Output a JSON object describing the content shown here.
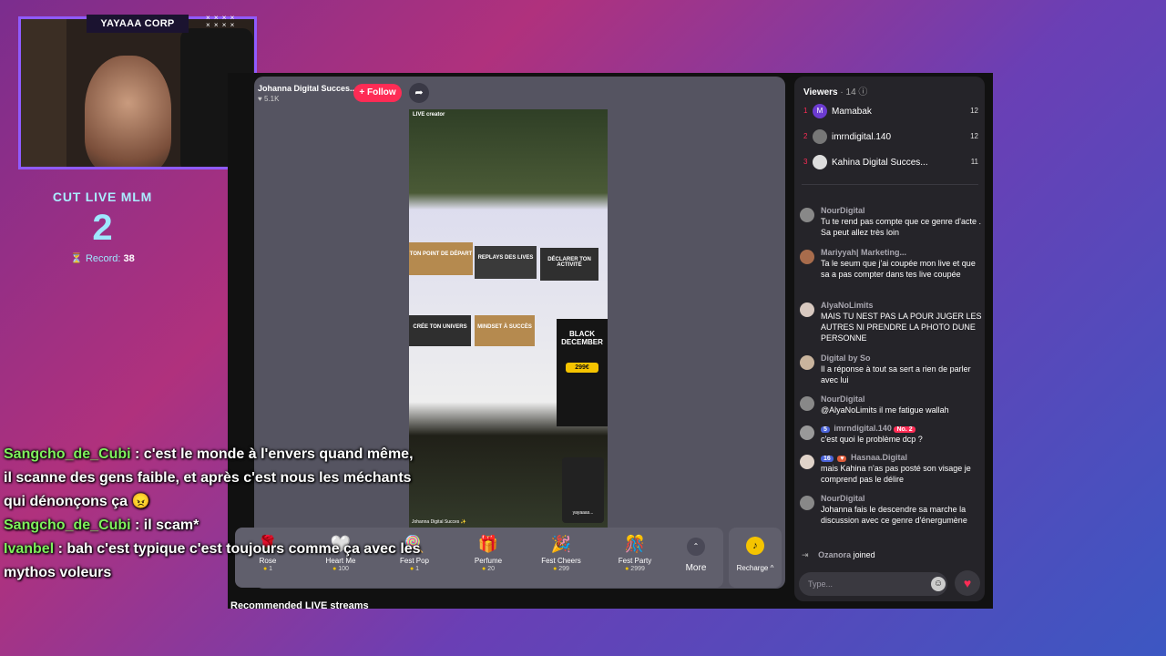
{
  "overlay": {
    "cam_label": "YAYAAA CORP",
    "cam_dots": "× × × ×\n× × × ×",
    "counter_title": "CUT LIVE MLM",
    "counter_value": "2",
    "record_label": "Record:",
    "record_value": "38"
  },
  "live": {
    "host_name": "Johanna Digital Succes...",
    "host_likes": "♥ 5.1K",
    "follow_label": "+ Follow",
    "share_icon": "share-icon"
  },
  "phone": {
    "live_tag": "LIVE creator",
    "card1": "TON POINT DE DÉPART",
    "card2": "REPLAYS DES LIVES",
    "card3": "DÉCLARER TON ACTIVITÉ",
    "card4": "CRÉE TON UNIVERS",
    "card5": "MINDSET À SUCCÈS",
    "promo_title": "BLACK DECEMBER",
    "promo_price": "299€",
    "mini_label": "yayaaas...",
    "footer": "Johanna Digital Succes ✨"
  },
  "gifts": [
    {
      "icon": "🌹",
      "name": "Rose",
      "price": "1"
    },
    {
      "icon": "🤍",
      "name": "Heart Me",
      "price": "100"
    },
    {
      "icon": "🍭",
      "name": "Fest Pop",
      "price": "1"
    },
    {
      "icon": "🎁",
      "name": "Perfume",
      "price": "20"
    },
    {
      "icon": "🎉",
      "name": "Fest Cheers",
      "price": "299"
    },
    {
      "icon": "🎊",
      "name": "Fest Party",
      "price": "2999"
    }
  ],
  "more_label": "More",
  "recharge_label": "Recharge ^",
  "recommended_title": "Recommended LIVE streams",
  "viewers": {
    "title": "Viewers",
    "count": "· 14 ⓘ",
    "list": [
      {
        "rank": "1",
        "initial": "M",
        "name": "Mamabak",
        "score": "12"
      },
      {
        "rank": "2",
        "initial": "",
        "name": "imrndigital.140",
        "score": "12"
      },
      {
        "rank": "3",
        "initial": "",
        "name": "Kahina Digital Succes...",
        "score": "11"
      }
    ]
  },
  "chat": [
    {
      "user": "NourDigital",
      "text": "Tu te rend pas compte que ce genre d'acte . Sa peut allez très loin"
    },
    {
      "user": "Mariyyah| Marketing...",
      "text": "Ta le seum que j'ai coupée mon live et que sa a pas compter dans tes live coupée"
    },
    {
      "user": "AlyaNoLimits",
      "text": "MAIS TU NEST PAS LA POUR JUGER LES AUTRES NI PRENDRE LA PHOTO DUNE PERSONNE"
    },
    {
      "user": "Digital by So",
      "text": "Il a réponse à tout sa sert a rien de parler avec lui"
    },
    {
      "user": "NourDigital",
      "text": "@AlyaNoLimits il me fatigue wallah"
    },
    {
      "user": "imrndigital.140",
      "badge1": "5",
      "badge2": "No. 2",
      "text": "c'est quoi le problème dcp ?"
    },
    {
      "user": "Hasnaa.Digital",
      "badge1": "16",
      "text": "mais Kahina n'as pas posté son visage je comprend pas le délire"
    },
    {
      "user": "NourDigital",
      "text": "Johanna fais le descendre sa marche la discussion avec ce genre d'énergumène"
    }
  ],
  "joined": {
    "user": "Ozanora",
    "text": "joined"
  },
  "input_placeholder": "Type...",
  "twitch_chat": [
    {
      "user": "Sangcho_de_Cubi",
      "text": ": c'est le monde à l'envers quand même, il scanne des gens faible, et après c'est nous les méchants qui dénonçons ça 😠"
    },
    {
      "user": "Sangcho_de_Cubi",
      "text": ": il scam*"
    },
    {
      "user": "Ivanbel",
      "text": ": bah c'est typique c'est toujours comme ça avec les mythos voleurs"
    }
  ]
}
